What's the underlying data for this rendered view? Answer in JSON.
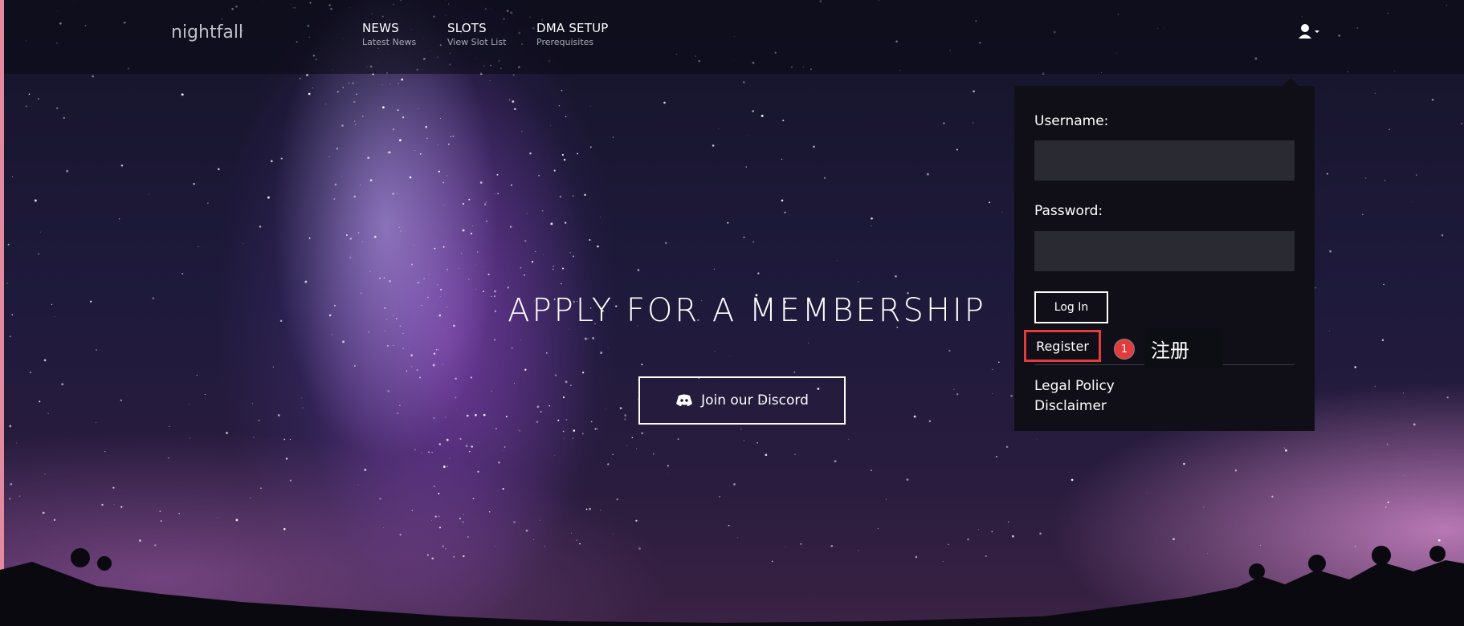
{
  "brand": "nightfall",
  "nav": [
    {
      "title": "NEWS",
      "subtitle": "Latest News"
    },
    {
      "title": "SLOTS",
      "subtitle": "View Slot List"
    },
    {
      "title": "DMA SETUP",
      "subtitle": "Prerequisites"
    }
  ],
  "user_menu": {
    "icon": "user-icon",
    "caret": "caret-down-icon"
  },
  "hero": {
    "title": "APPLY FOR A MEMBERSHIP",
    "discord_button": {
      "label": "Join our Discord",
      "icon": "discord-icon"
    }
  },
  "login": {
    "username_label": "Username:",
    "username_value": "",
    "password_label": "Password:",
    "password_value": "",
    "login_button": "Log In",
    "register_link": "Register",
    "legal_policy": "Legal Policy",
    "disclaimer": "Disclaimer"
  },
  "annotation": {
    "badge": "1",
    "text": "注册",
    "highlight_color": "#e43c3c"
  },
  "colors": {
    "accent_red": "#e43c3c",
    "dropdown_bg": "#100f18",
    "input_bg": "#2a2a32"
  }
}
